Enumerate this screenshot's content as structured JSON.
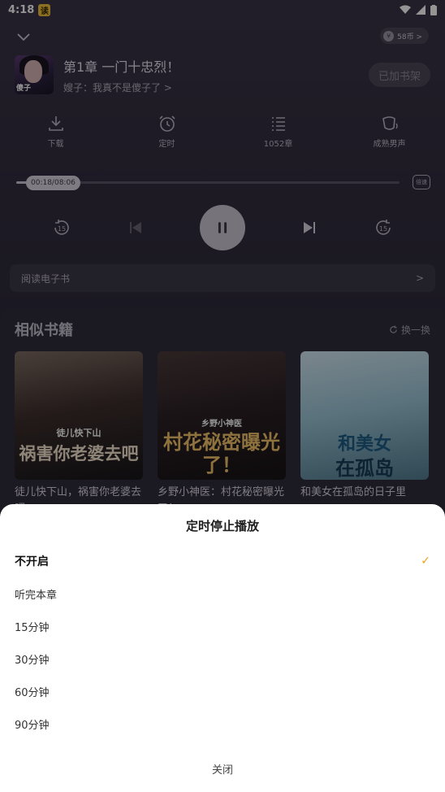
{
  "status_bar": {
    "time": "4:18",
    "app_badge": "读"
  },
  "header": {
    "coins": "58币 >"
  },
  "now_playing": {
    "cover_text": "傻子",
    "chapter": "第1章 一门十忠烈！",
    "author": "嫂子：我真不是傻子了 >",
    "shelf_button": "已加书架"
  },
  "tools": [
    {
      "label": "下载",
      "icon": "download-icon"
    },
    {
      "label": "定时",
      "icon": "alarm-clock-icon"
    },
    {
      "label": "1052章",
      "icon": "chapter-list-icon"
    },
    {
      "label": "成熟男声",
      "icon": "voice-icon"
    }
  ],
  "progress": {
    "time": "00:18/08:06",
    "fraction": 0.037,
    "speed_label": "倍速",
    "speed_sup": "1.0x"
  },
  "read_ebook": {
    "label": "阅读电子书",
    "chevron": ">"
  },
  "similar": {
    "title": "相似书籍",
    "refresh": "换一换",
    "books": [
      {
        "name": "徒儿快下山，祸害你老婆去吧",
        "cover_text_top": "徒儿快下山",
        "cover_text_main": "祸害你老婆去吧"
      },
      {
        "name": "乡野小神医：村花秘密曝光了！",
        "cover_text_top": "乡野小神医",
        "cover_text_main": "村花秘密曝光了！"
      },
      {
        "name": "和美女在孤岛的日子里",
        "cover_text_top": "和美女",
        "cover_text_main": "在孤岛"
      }
    ]
  },
  "timer_sheet": {
    "title": "定时停止播放",
    "options": [
      {
        "label": "不开启",
        "selected": true
      },
      {
        "label": "听完本章",
        "selected": false
      },
      {
        "label": "15分钟",
        "selected": false
      },
      {
        "label": "30分钟",
        "selected": false
      },
      {
        "label": "60分钟",
        "selected": false
      },
      {
        "label": "90分钟",
        "selected": false
      }
    ],
    "check_mark": "✓",
    "close": "关闭"
  }
}
